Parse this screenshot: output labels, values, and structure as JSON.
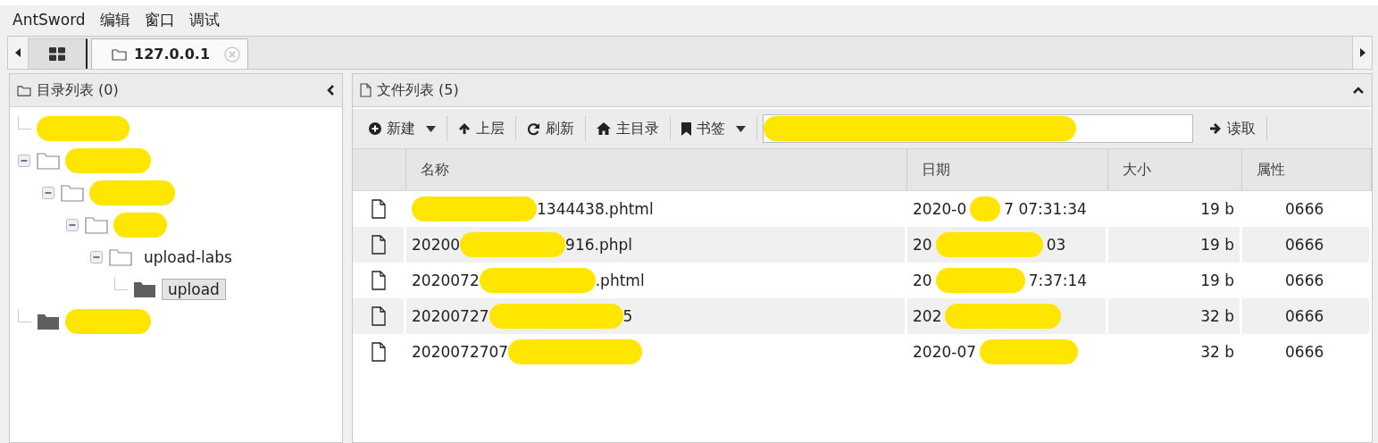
{
  "menu": [
    "AntSword",
    "编辑",
    "窗口",
    "调试"
  ],
  "tabs": [
    {
      "kind": "grid",
      "selected": false
    },
    {
      "kind": "folder",
      "label": "127.0.0.1",
      "selected": true
    }
  ],
  "left_panel": {
    "title": "目录列表 (0)",
    "tree": [
      {
        "redacted": true
      },
      {
        "redacted": true,
        "expanded": true,
        "children": [
          {
            "redacted": true,
            "expanded": true,
            "children": [
              {
                "redacted": true,
                "expanded": true,
                "children": [
                  {
                    "label": "upload-labs",
                    "selected": false,
                    "expanded": true,
                    "children": [
                      {
                        "label": "upload",
                        "selected": true
                      }
                    ]
                  }
                ]
              }
            ]
          }
        ]
      },
      {
        "redacted": true,
        "filled": true
      }
    ]
  },
  "right_panel": {
    "title": "文件列表 (5)",
    "toolbar": [
      {
        "label": "新建",
        "dropdown": true
      },
      {
        "label": "上层",
        "dropdown": false
      },
      {
        "label": "刷新",
        "dropdown": false
      },
      {
        "label": "主目录",
        "dropdown": false
      },
      {
        "label": "书签",
        "dropdown": true
      }
    ],
    "path_field": {
      "redacted": true
    },
    "read_button": "读取",
    "columns": [
      "名称",
      "日期",
      "大小",
      "属性"
    ],
    "rows": [
      {
        "name_head": "",
        "name_tail": "1344438.phtml",
        "date_head": "2020-0",
        "date_tail": "7 07:31:34",
        "size": "19 b",
        "attr": "0666"
      },
      {
        "name_head": "20200",
        "name_tail": "916.phpl",
        "date_head": "20",
        "date_tail": "03",
        "size": "19 b",
        "attr": "0666"
      },
      {
        "name_head": "2020072",
        "name_tail": ".phtml",
        "date_head": "20",
        "date_tail": "7:37:14",
        "size": "19 b",
        "attr": "0666"
      },
      {
        "name_head": "20200727",
        "name_tail": "5",
        "date_head": "202",
        "date_tail": "",
        "size": "32 b",
        "attr": "0666"
      },
      {
        "name_head": "2020072707",
        "name_tail": "",
        "date_head": "2020-07",
        "date_tail": "",
        "size": "32 b",
        "attr": "0666"
      }
    ],
    "date_redacted": true
  }
}
